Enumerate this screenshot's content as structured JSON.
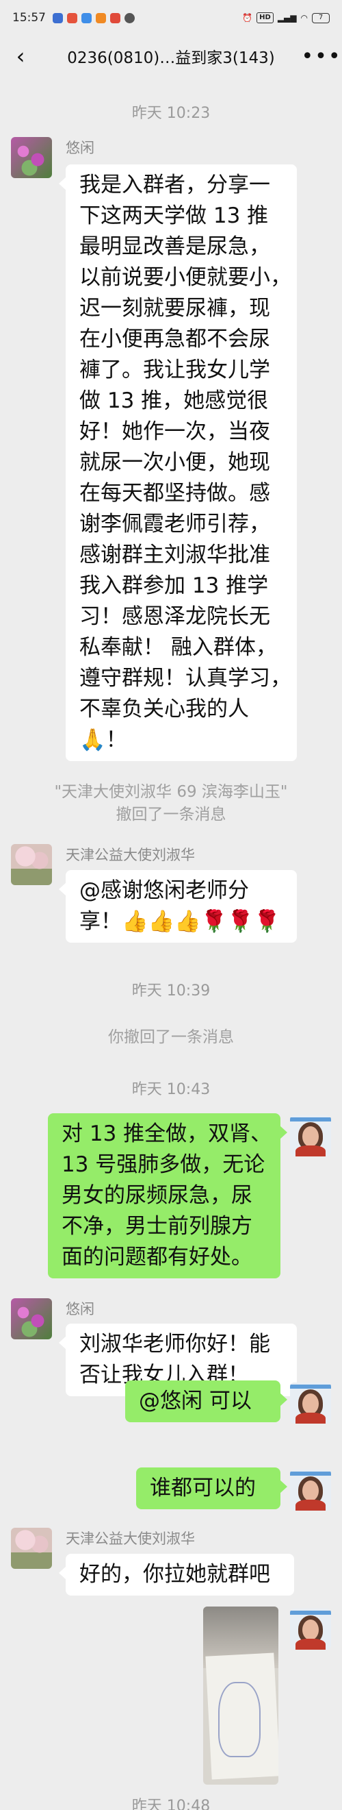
{
  "status_bar": {
    "time": "15:57",
    "signal_chip": "HD",
    "battery": "7"
  },
  "header": {
    "title": "0236(0810)…益到家3(143)",
    "back_icon": "back-arrow-icon",
    "more_icon": "more-dots-icon"
  },
  "messages": {
    "t1": "昨天 10:23",
    "m1_name": "悠闲",
    "m1_lines": [
      "我是入群者，分享一",
      "下这两天学做 13 推",
      "最明显改善是尿急，",
      "以前说要小便就要小，",
      "迟一刻就要尿褲，现",
      "在小便再急都不会尿",
      "褲了。我让我女儿学",
      "做 13 推，她感觉很",
      "好！她作一次，当夜",
      "就尿一次小便，她现",
      "在每天都坚持做。感",
      "谢李佩霞老师引荐，",
      "感谢群主刘淑华批准",
      "我入群参加 13 推学",
      "习！感恩泽龙院长无",
      "私奉献！ 融入群体，",
      "遵守群规！认真学习，",
      "不辜负关心我的人",
      "🙏！"
    ],
    "sys1_line1": "\"天津大使刘淑华 69 滨海李山玉\"",
    "sys1_line2": "撤回了一条消息",
    "m2_name": "天津公益大使刘淑华",
    "m2_lines": [
      "@感谢悠闲老师分",
      "享！👍👍👍🌹🌹🌹"
    ],
    "t2": "昨天 10:39",
    "sys2": "你撤回了一条消息",
    "t3": "昨天 10:43",
    "m3_lines": [
      "对 13 推全做，双肾、",
      "13 号强肺多做，无论",
      "男女的尿频尿急，尿",
      "不净，男士前列腺方",
      "面的问题都有好处。"
    ],
    "m4_name": "悠闲",
    "m4_lines": [
      "刘淑华老师你好！能",
      "否让我女儿入群！"
    ],
    "m5": "@悠闲   可以",
    "m6": "谁都可以的",
    "m7_name": "天津公益大使刘淑华",
    "m7": "好的，你拉她就群吧",
    "t4": "昨天 10:48"
  },
  "colors": {
    "background": "#ededed",
    "bubble_self": "#95ec69",
    "bubble_other": "#ffffff"
  }
}
